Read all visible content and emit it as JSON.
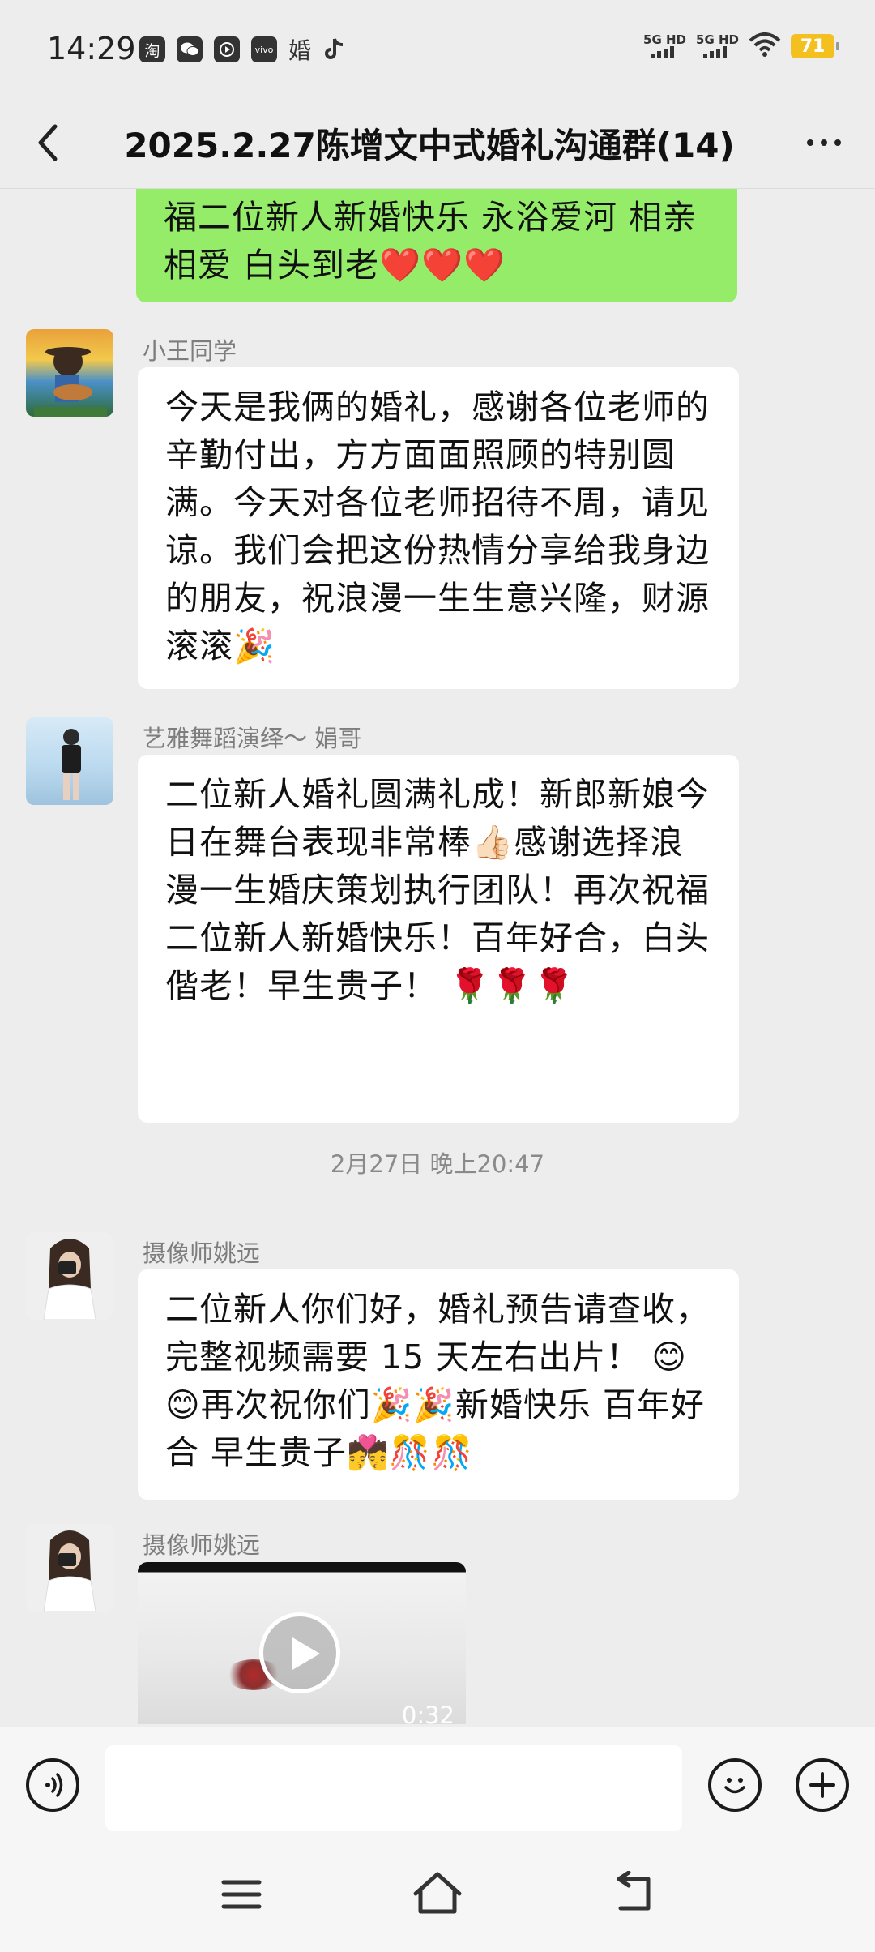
{
  "status_bar": {
    "time": "14:29",
    "app_icons": [
      "taobao-icon",
      "wechat-icon",
      "video-icon",
      "vivo-icon",
      "wedding-app-icon",
      "tiktok-icon"
    ],
    "taobao_label": "淘",
    "vivo_label": "vivo",
    "wedding_label": "婚",
    "signal_1": "5G HD",
    "signal_2": "5G HD",
    "battery": "71"
  },
  "header": {
    "title": "2025.2.27陈增文中式婚礼沟通群(14)"
  },
  "messages": [
    {
      "type": "text",
      "side": "right",
      "text": "福二位新人新婚快乐 永浴爱河 相亲相爱 白头到老❤️❤️❤️"
    },
    {
      "type": "text",
      "side": "left",
      "sender": "小王同学",
      "text": "今天是我俩的婚礼，感谢各位老师的辛勤付出，方方面面照顾的特别圆满。今天对各位老师招待不周，请见谅。我们会把这份热情分享给我身边的朋友，祝浪漫一生生意兴隆，财源滚滚🎉"
    },
    {
      "type": "text",
      "side": "left",
      "sender": "艺雅舞蹈演绎～ 娟哥",
      "text": "二位新人婚礼圆满礼成！新郎新娘今日在舞台表现非常棒👍🏻感谢选择浪漫一生婚庆策划执行团队！再次祝福二位新人新婚快乐！百年好合，白头偕老！早生贵子！ 🌹🌹🌹"
    },
    {
      "type": "timestamp",
      "text": "2月27日 晚上20:47"
    },
    {
      "type": "text",
      "side": "left",
      "sender": "摄像师姚远",
      "text": "二位新人你们好，婚礼预告请查收， 完整视频需要 15 天左右出片！ 😊😊再次祝你们🎉🎉新婚快乐  百年好合  早生贵子💏🎊🎊"
    },
    {
      "type": "video",
      "side": "left",
      "sender": "摄像师姚远",
      "duration": "0:32"
    }
  ],
  "colors": {
    "background": "#ededed",
    "self_bubble": "#95ec69",
    "other_bubble": "#ffffff",
    "battery": "#f4c020"
  }
}
